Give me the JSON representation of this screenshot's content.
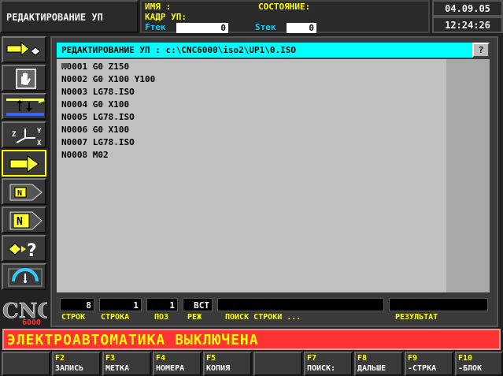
{
  "header": {
    "mode": "РЕДАКТИРОВАНИЕ УП",
    "name_label": "ИМЯ :",
    "state_label": "СОСТОЯНИЕ:",
    "frame_label": "КАДР УП:",
    "ftek_label": "Fтек",
    "ftek_value": "0",
    "stek_label": "Sтек",
    "stek_value": "0",
    "date": "04.09.05",
    "time": "12:24:26"
  },
  "toolbar": {
    "icons": [
      "auto-mode-icon",
      "manual-hand-icon",
      "reference-icon",
      "axis-coordinates-icon",
      "program-arrow-icon",
      "n-block-frame-icon",
      "n-block-icon",
      "help-diagnostics-icon",
      "gauge-icon"
    ],
    "logo_text": "CNC",
    "logo_sub": "6000"
  },
  "editor": {
    "title": "РЕДАКТИРОВАНИЕ УП : c:\\CNC6000\\iso2\\UP1\\0.ISO",
    "help": "?",
    "lines": [
      "N0001 G0 Z150",
      "N0002 G0 X100 Y100",
      "N0003 LG78.ISO",
      "N0004 G0 X100",
      "N0005 LG78.ISO",
      "N0006 G0 X100",
      "N0007 LG78.ISO",
      "N0008 M02"
    ]
  },
  "status": {
    "lines_count": "8",
    "lines_count_label": "СТРОК",
    "line": "1",
    "line_label": "СТРОКА",
    "pos": "1",
    "pos_label": "ПОЗ",
    "mode": "ВСТ",
    "mode_label": "РЕЖ",
    "search_value": "",
    "search_label": "ПОИСК СТРОКИ ...",
    "result_value": "",
    "result_label": "РЕЗУЛЬТАТ"
  },
  "alarm": "ЭЛЕКТРОАВТОМАТИКА ВЫКЛЮЧЕНА",
  "fkeys": [
    {
      "key": "",
      "label": ""
    },
    {
      "key": "F2",
      "label": "ЗАПИСЬ"
    },
    {
      "key": "F3",
      "label": "МЕТКА"
    },
    {
      "key": "F4",
      "label": "НОМЕРА"
    },
    {
      "key": "F5",
      "label": "КОПИЯ"
    },
    {
      "key": "",
      "label": ""
    },
    {
      "key": "F7",
      "label": "ПОИСК:"
    },
    {
      "key": "F8",
      "label": "ДАЛЬШЕ"
    },
    {
      "key": "F9",
      "label": "-СТРКА"
    },
    {
      "key": "F10",
      "label": "-БЛОК"
    }
  ],
  "colors": {
    "title_bg": "#00ffff",
    "label_yellow": "#ffff00",
    "alarm_bg": "#ff3333",
    "editor_bg": "#c0c0c0"
  }
}
